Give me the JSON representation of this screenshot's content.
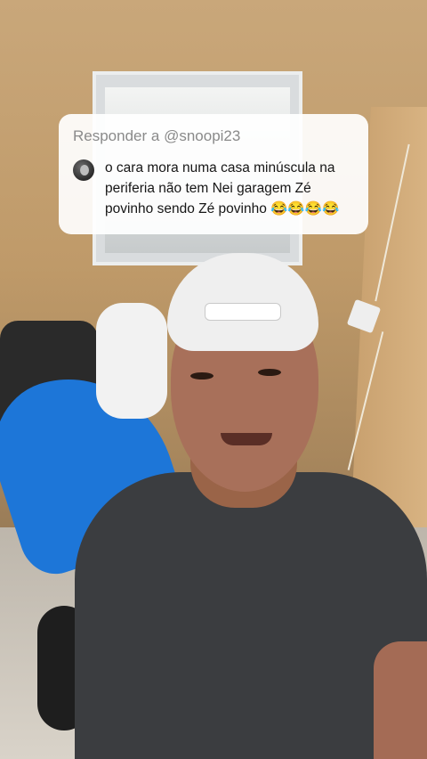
{
  "reply": {
    "header": "Responder a @snoopi23",
    "avatar_icon": "user-avatar-icon",
    "comment": "o cara mora numa casa minúscula na\nperiferia não tem Nei garagem Zé\npovinho sendo Zé povinho 😂😂😂😂"
  },
  "colors": {
    "card_background": "#ffffff",
    "header_text": "#8a8a8a",
    "comment_text": "#161616"
  }
}
